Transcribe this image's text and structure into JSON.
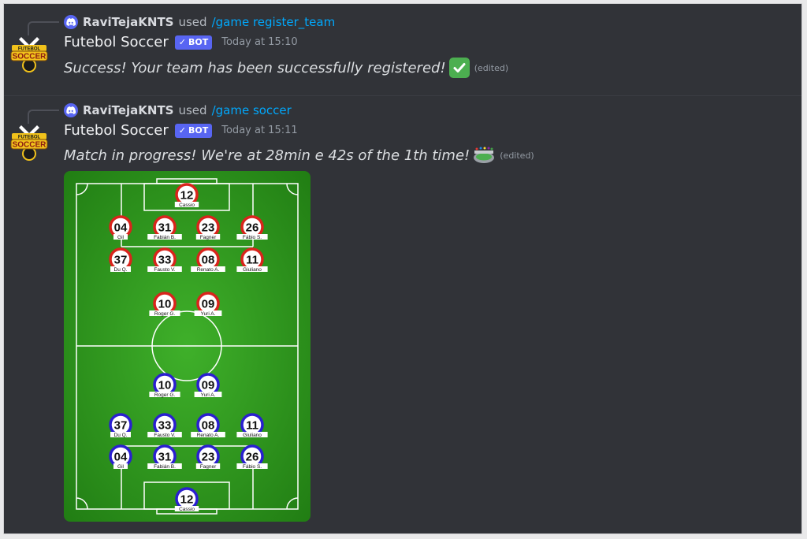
{
  "messages": [
    {
      "reply": {
        "user": "RaviTejaKNTS",
        "used": "used",
        "command": "/game register_team"
      },
      "author": {
        "name": "Futebol Soccer",
        "badge": "BOT",
        "time": "Today at 15:10"
      },
      "text": "Success! Your team has been successfully registered!",
      "edited": "(edited)"
    },
    {
      "reply": {
        "user": "RaviTejaKNTS",
        "used": "used",
        "command": "/game soccer"
      },
      "author": {
        "name": "Futebol Soccer",
        "badge": "BOT",
        "time": "Today at 15:11"
      },
      "text": "Match in progress! We're at 28min e 42s of the 1th time!",
      "edited": "(edited)"
    }
  ],
  "avatar_text": {
    "top": "FUTEBOL",
    "main": "SOCCER"
  },
  "field": {
    "colors": {
      "grass": "#2f9a1e",
      "home": "#d9241c",
      "away": "#2a1fd0",
      "line": "#ffffff"
    },
    "home_team": [
      {
        "number": "12",
        "name": "Cassio"
      },
      {
        "number": "04",
        "name": "Gil"
      },
      {
        "number": "31",
        "name": "Fabián B."
      },
      {
        "number": "23",
        "name": "Fagner"
      },
      {
        "number": "26",
        "name": "Fábio S."
      },
      {
        "number": "37",
        "name": "Du Q."
      },
      {
        "number": "33",
        "name": "Fausto V."
      },
      {
        "number": "08",
        "name": "Renato A."
      },
      {
        "number": "11",
        "name": "Giuliano"
      },
      {
        "number": "10",
        "name": "Roger G."
      },
      {
        "number": "09",
        "name": "Yuri A."
      }
    ],
    "away_team": [
      {
        "number": "10",
        "name": "Roger G."
      },
      {
        "number": "09",
        "name": "Yuri A."
      },
      {
        "number": "37",
        "name": "Du Q."
      },
      {
        "number": "33",
        "name": "Fausto V."
      },
      {
        "number": "08",
        "name": "Renato A."
      },
      {
        "number": "11",
        "name": "Giuliano"
      },
      {
        "number": "04",
        "name": "Gil"
      },
      {
        "number": "31",
        "name": "Fabián B."
      },
      {
        "number": "23",
        "name": "Fagner"
      },
      {
        "number": "26",
        "name": "Fábio S."
      },
      {
        "number": "12",
        "name": "Cassio"
      }
    ]
  }
}
